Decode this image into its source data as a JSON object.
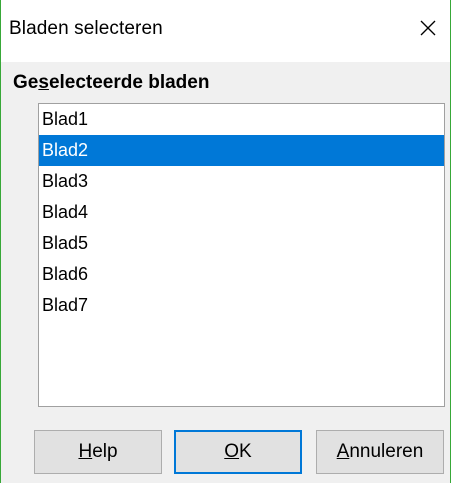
{
  "window": {
    "title": "Bladen selecteren",
    "close_icon": "close-icon"
  },
  "section": {
    "label_prefix": "Ge",
    "label_mnemonic": "s",
    "label_suffix": "electeerde bladen"
  },
  "sheets": [
    {
      "label": "Blad1",
      "selected": false
    },
    {
      "label": "Blad2",
      "selected": true
    },
    {
      "label": "Blad3",
      "selected": false
    },
    {
      "label": "Blad4",
      "selected": false
    },
    {
      "label": "Blad5",
      "selected": false
    },
    {
      "label": "Blad6",
      "selected": false
    },
    {
      "label": "Blad7",
      "selected": false
    }
  ],
  "buttons": {
    "help": {
      "mnemonic": "H",
      "rest": "elp"
    },
    "ok": {
      "mnemonic": "O",
      "rest": "K"
    },
    "cancel": {
      "mnemonic": "A",
      "rest": "nnuleren"
    }
  },
  "colors": {
    "selection": "#0078d7",
    "window_border": "#38a838"
  }
}
